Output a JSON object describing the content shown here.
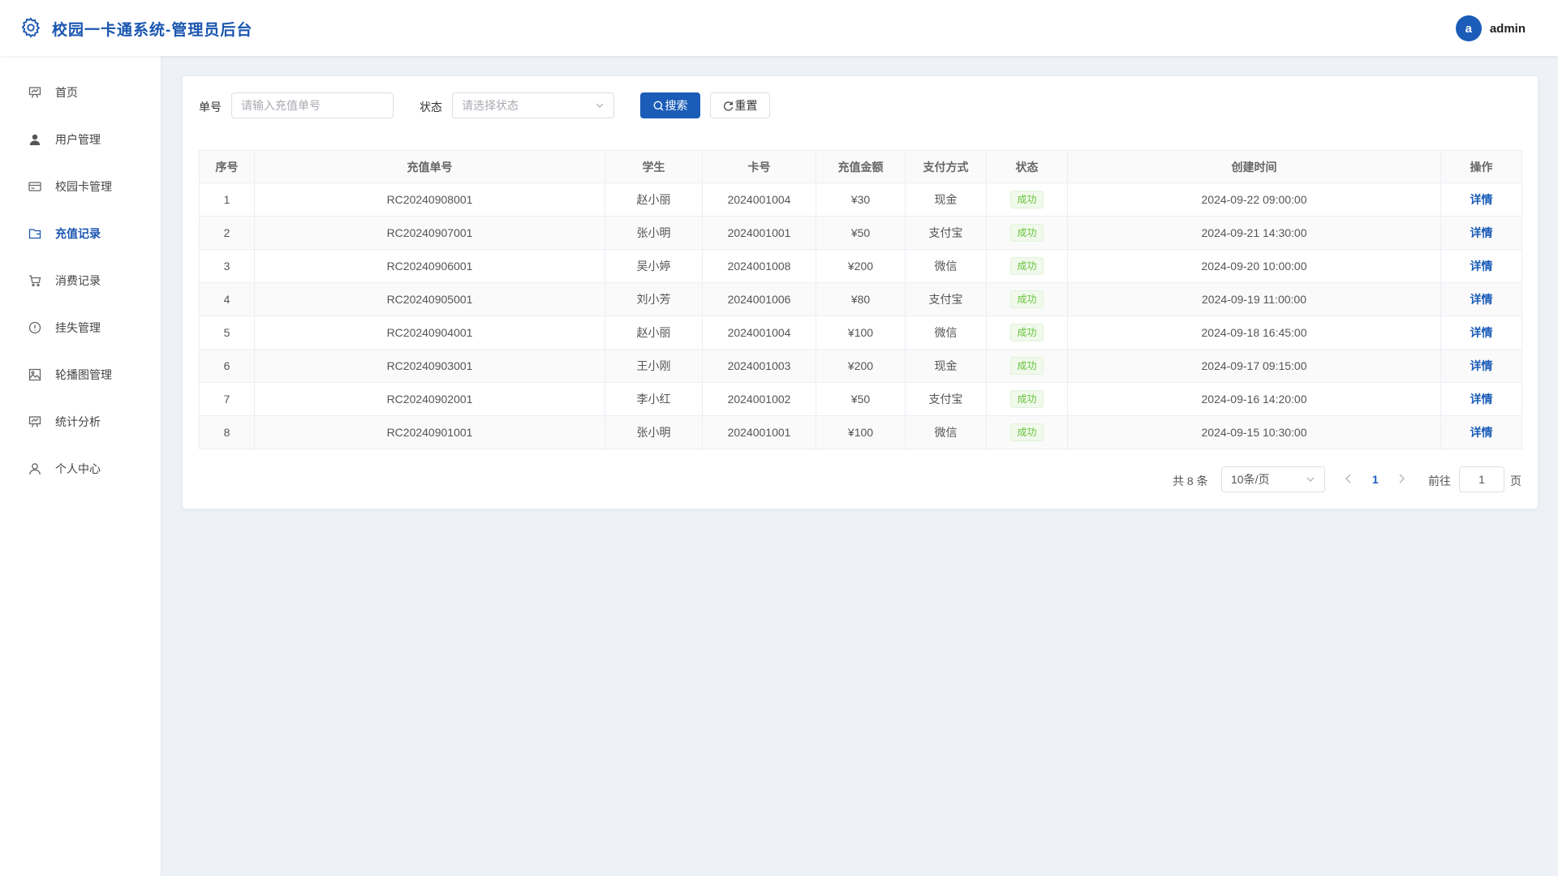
{
  "header": {
    "app_title": "校园一卡通系统-管理员后台",
    "avatar_letter": "a",
    "username": "admin",
    "brand_color": "#1a56b0"
  },
  "sidebar": {
    "items": [
      {
        "label": "首页",
        "icon": "presentation-board-icon"
      },
      {
        "label": "用户管理",
        "icon": "user-icon"
      },
      {
        "label": "校园卡管理",
        "icon": "credit-card-icon"
      },
      {
        "label": "充值记录",
        "icon": "wallet-folder-icon",
        "active": true
      },
      {
        "label": "消费记录",
        "icon": "shopping-cart-icon"
      },
      {
        "label": "挂失管理",
        "icon": "warning-circle-icon"
      },
      {
        "label": "轮播图管理",
        "icon": "image-icon"
      },
      {
        "label": "统计分析",
        "icon": "presentation-board-icon"
      },
      {
        "label": "个人中心",
        "icon": "user-outline-icon"
      }
    ]
  },
  "filters": {
    "order_no_label": "单号",
    "order_no_placeholder": "请输入充值单号",
    "order_no_value": "",
    "status_label": "状态",
    "status_placeholder": "请选择状态",
    "search_label": "搜索",
    "reset_label": "重置"
  },
  "table": {
    "headers": [
      "序号",
      "充值单号",
      "学生",
      "卡号",
      "充值金额",
      "支付方式",
      "状态",
      "创建时间",
      "操作"
    ],
    "rows": [
      {
        "idx": "1",
        "order": "RC20240908001",
        "student": "赵小丽",
        "card": "2024001004",
        "amount": "¥30",
        "pay": "现金",
        "status": "成功",
        "time": "2024-09-22 09:00:00",
        "action": "详情"
      },
      {
        "idx": "2",
        "order": "RC20240907001",
        "student": "张小明",
        "card": "2024001001",
        "amount": "¥50",
        "pay": "支付宝",
        "status": "成功",
        "time": "2024-09-21 14:30:00",
        "action": "详情"
      },
      {
        "idx": "3",
        "order": "RC20240906001",
        "student": "吴小婷",
        "card": "2024001008",
        "amount": "¥200",
        "pay": "微信",
        "status": "成功",
        "time": "2024-09-20 10:00:00",
        "action": "详情"
      },
      {
        "idx": "4",
        "order": "RC20240905001",
        "student": "刘小芳",
        "card": "2024001006",
        "amount": "¥80",
        "pay": "支付宝",
        "status": "成功",
        "time": "2024-09-19 11:00:00",
        "action": "详情"
      },
      {
        "idx": "5",
        "order": "RC20240904001",
        "student": "赵小丽",
        "card": "2024001004",
        "amount": "¥100",
        "pay": "微信",
        "status": "成功",
        "time": "2024-09-18 16:45:00",
        "action": "详情"
      },
      {
        "idx": "6",
        "order": "RC20240903001",
        "student": "王小刚",
        "card": "2024001003",
        "amount": "¥200",
        "pay": "现金",
        "status": "成功",
        "time": "2024-09-17 09:15:00",
        "action": "详情"
      },
      {
        "idx": "7",
        "order": "RC20240902001",
        "student": "李小红",
        "card": "2024001002",
        "amount": "¥50",
        "pay": "支付宝",
        "status": "成功",
        "time": "2024-09-16 14:20:00",
        "action": "详情"
      },
      {
        "idx": "8",
        "order": "RC20240901001",
        "student": "张小明",
        "card": "2024001001",
        "amount": "¥100",
        "pay": "微信",
        "status": "成功",
        "time": "2024-09-15 10:30:00",
        "action": "详情"
      }
    ]
  },
  "pagination": {
    "total_text": "共 8 条",
    "page_size": "10条/页",
    "current_page": "1",
    "goto_label": "前往",
    "goto_value": "1",
    "page_suffix": "页"
  }
}
